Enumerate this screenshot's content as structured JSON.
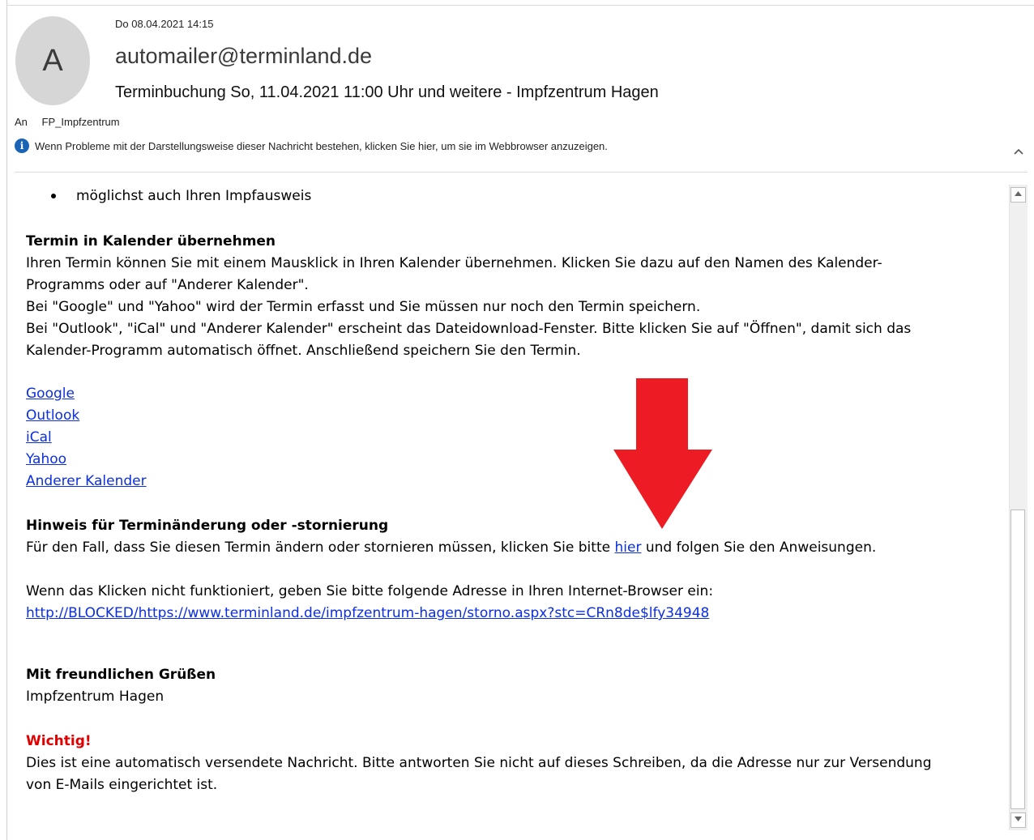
{
  "header": {
    "avatar_letter": "A",
    "date": "Do 08.04.2021 14:15",
    "from": "automailer@terminland.de",
    "subject": "Terminbuchung So, 11.04.2021 11:00 Uhr und weitere - Impfzentrum Hagen",
    "to_label": "An",
    "to_value": "FP_Impfzentrum",
    "info_text": "Wenn Probleme mit der Darstellungsweise dieser Nachricht bestehen, klicken Sie hier, um sie im Webbrowser anzuzeigen.",
    "collapse_icon": "chevron-up-icon"
  },
  "body": {
    "bullet_item": "möglichst auch Ihren Impfausweis",
    "calendar": {
      "heading": "Termin in Kalender übernehmen",
      "line1": "Ihren Termin können Sie mit einem Mausklick in Ihren Kalender übernehmen. Klicken Sie dazu auf den Namen des Kalender-",
      "line2": "Programms oder auf \"Anderer Kalender\".",
      "line3": "Bei \"Google\" und \"Yahoo\" wird der Termin erfasst und Sie müssen nur noch den Termin speichern.",
      "line4": "Bei \"Outlook\", \"iCal\" und \"Anderer Kalender\" erscheint das Dateidownload-Fenster. Bitte klicken Sie auf \"Öffnen\", damit sich das",
      "line5": "Kalender-Programm automatisch öffnet. Anschließend speichern Sie den Termin."
    },
    "links": [
      "Google",
      "Outlook",
      "iCal",
      "Yahoo",
      "Anderer Kalender"
    ],
    "change": {
      "heading": "Hinweis für Terminänderung oder -stornierung",
      "text_before": "Für den Fall, dass Sie diesen Termin ändern oder stornieren müssen, klicken Sie bitte ",
      "link": "hier",
      "text_after": " und folgen Sie den Anweisungen.",
      "fallback_text": "Wenn das Klicken nicht funktioniert, geben Sie bitte folgende Adresse in Ihren Internet-Browser ein:",
      "url": "http://BLOCKED/https://www.terminland.de/impfzentrum-hagen/storno.aspx?stc=CRn8de$lfy34948"
    },
    "closing": {
      "greeting": "Mit freundlichen Grüßen",
      "signature": "Impfzentrum Hagen"
    },
    "important": {
      "label": "Wichtig!",
      "line1": "Dies ist eine automatisch versendete Nachricht. Bitte antworten Sie nicht auf dieses Schreiben, da die Adresse nur zur Versendung",
      "line2": "von E-Mails eingerichtet ist."
    }
  },
  "annotation": {
    "arrow_color": "#ed1c24",
    "arrow_icon": "down-arrow-icon"
  },
  "scrollbar": {
    "up_icon": "scroll-up-icon",
    "down_icon": "scroll-down-icon",
    "position_fraction": 0.5
  }
}
